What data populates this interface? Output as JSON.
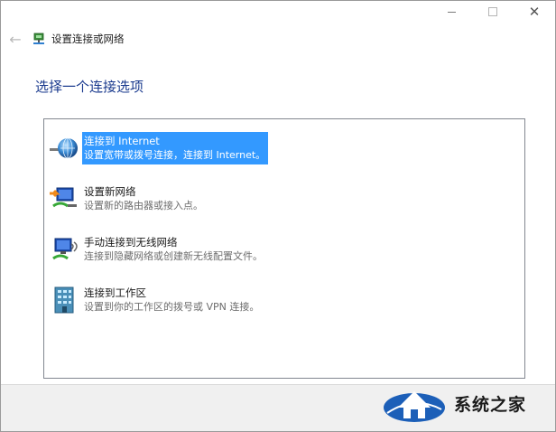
{
  "window": {
    "title": "设置连接或网络",
    "caption": {
      "minimize": "minimize",
      "maximize": "maximize",
      "close": "✕"
    }
  },
  "heading": "选择一个连接选项",
  "options": [
    {
      "title": "连接到 Internet",
      "description": "设置宽带或拨号连接，连接到 Internet。",
      "icon": "globe-network-icon",
      "selected": true
    },
    {
      "title": "设置新网络",
      "description": "设置新的路由器或接入点。",
      "icon": "new-network-icon",
      "selected": false
    },
    {
      "title": "手动连接到无线网络",
      "description": "连接到隐藏网络或创建新无线配置文件。",
      "icon": "wireless-network-icon",
      "selected": false
    },
    {
      "title": "连接到工作区",
      "description": "设置到你的工作区的拨号或 VPN 连接。",
      "icon": "workplace-icon",
      "selected": false
    }
  ],
  "watermark": {
    "text": "系统之家"
  },
  "colors": {
    "selection": "#3399ff",
    "heading": "#1a3a8e",
    "footer": "#f0f0f0"
  }
}
